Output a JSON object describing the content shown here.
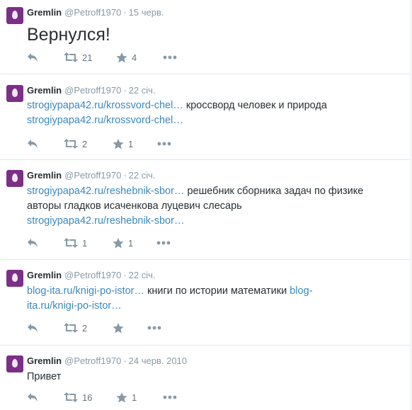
{
  "tweets": [
    {
      "name": "Gremlin",
      "handle": "@Petroff1970",
      "time": "15 черв.",
      "text": "Вернулся!",
      "retweets": "21",
      "favorites": "4"
    },
    {
      "name": "Gremlin",
      "handle": "@Petroff1970",
      "time": "22 січ.",
      "link1": "strogiypapa42.ru/krossvord-chel…",
      "plain": " кроссворд человек и природа",
      "link2": "strogiypapa42.ru/krossvord-chel…",
      "retweets": "2",
      "favorites": "1"
    },
    {
      "name": "Gremlin",
      "handle": "@Petroff1970",
      "time": "22 січ.",
      "link1": "strogiypapa42.ru/reshebnik-sbor…",
      "plain1": " решебник сборника задач по физике",
      "plain2": "авторы гладков исаченкова луцевич слесарь",
      "link2": "strogiypapa42.ru/reshebnik-sbor…",
      "retweets": "1",
      "favorites": "1"
    },
    {
      "name": "Gremlin",
      "handle": "@Petroff1970",
      "time": "22 січ.",
      "link1": "blog-ita.ru/knigi-po-istor…",
      "plain": " книги по истории математики ",
      "link2a": "blog-",
      "link2b": "ita.ru/knigi-po-istor…",
      "retweets": "2",
      "favorites": ""
    },
    {
      "name": "Gremlin",
      "handle": "@Petroff1970",
      "time": "24 черв. 2010",
      "text": "Привет",
      "retweets": "16",
      "favorites": "1"
    }
  ],
  "separator": "·",
  "icons": [
    "reply-icon",
    "retweet-icon",
    "favorite-icon",
    "more-icon"
  ],
  "colors": {
    "link": "#3b88c3",
    "muted": "#8899a6",
    "avatar": "#7b2f86"
  }
}
